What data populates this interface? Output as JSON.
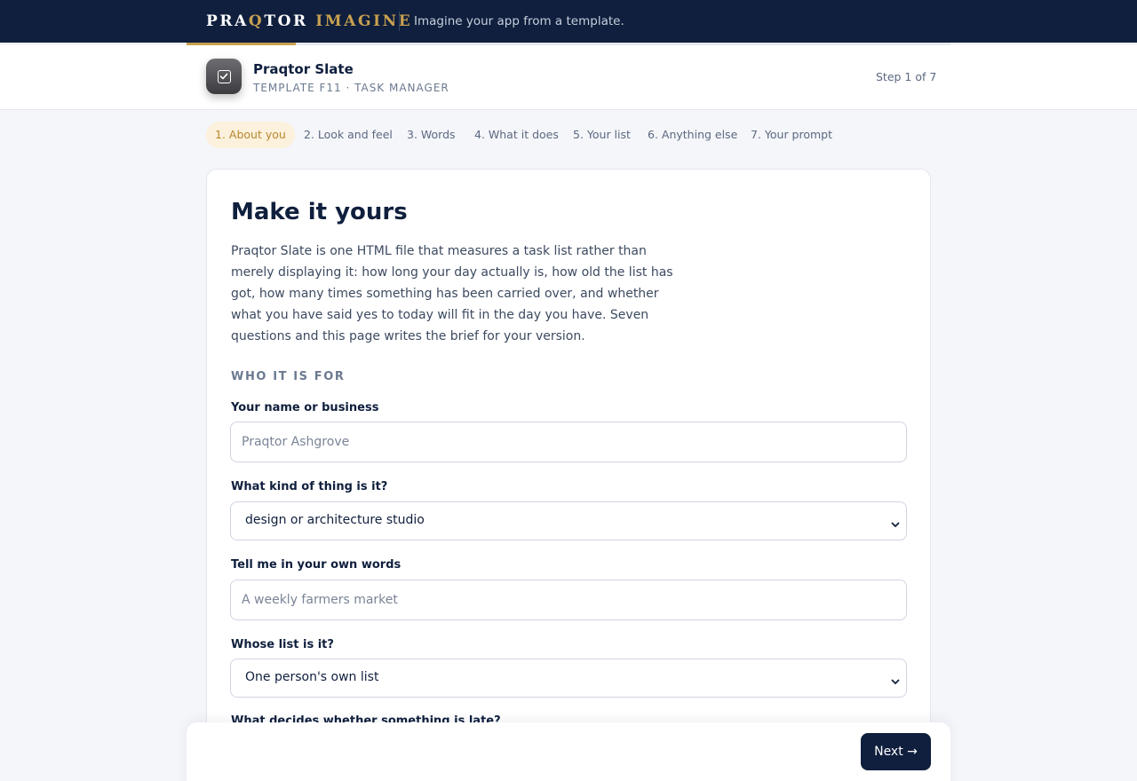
{
  "topbar": {
    "brand_part1": "PRA",
    "brand_q": "Q",
    "brand_part2": "TOR ",
    "brand_part3": "IMAGINE",
    "tagline": "Imagine your app from a template."
  },
  "progress": {
    "fraction": 0.1428,
    "color": "#c8a050"
  },
  "header": {
    "app_icon": "checkbox-icon",
    "app_name": "Praqtor Slate",
    "app_sub": "TEMPLATE F11 · TASK MANAGER",
    "step_count": "Step 1 of 7"
  },
  "steps": [
    {
      "label": "1. About you",
      "active": true
    },
    {
      "label": "2. Look and feel",
      "active": false
    },
    {
      "label": "3. Words",
      "active": false
    },
    {
      "label": "4. What it does",
      "active": false
    },
    {
      "label": "5. Your list",
      "active": false
    },
    {
      "label": "6. Anything else",
      "active": false
    },
    {
      "label": "7. Your prompt",
      "active": false
    }
  ],
  "card": {
    "title": "Make it yours",
    "intro": "Praqtor Slate is one HTML file that measures a task list rather than merely displaying it: how long your day actually is, how old the list has got, how many times something has been carried over, and whether what you have said yes to today will fit in the day you have. Seven questions and this page writes the brief for your version.",
    "section_label": "WHO IT IS FOR",
    "fields": {
      "name": {
        "label": "Your name or business",
        "placeholder": "Praqtor Ashgrove",
        "value": ""
      },
      "kind": {
        "label": "What kind of thing is it?",
        "value": "design or architecture studio"
      },
      "own_words": {
        "label": "Tell me in your own words",
        "placeholder": "A weekly farmers market",
        "value": ""
      },
      "whose_list": {
        "label": "Whose list is it?",
        "value": "One person's own list"
      },
      "late": {
        "label": "What decides whether something is late?"
      }
    }
  },
  "footer": {
    "next_label": "Next →"
  },
  "colors": {
    "navy": "#0f1f3d",
    "gold": "#c8a050",
    "background": "#f5f6fa"
  }
}
